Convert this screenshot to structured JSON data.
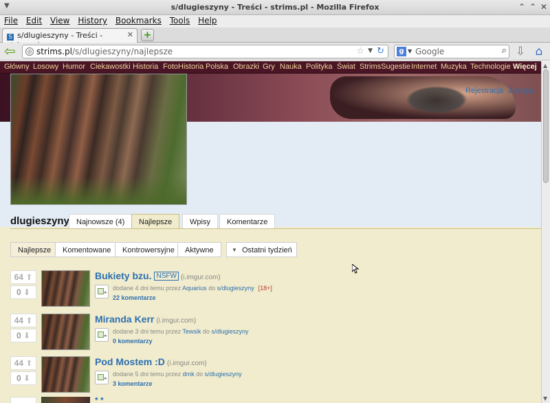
{
  "window": {
    "title": "s/dlugieszyny - Treści - strims.pl - Mozilla Firefox"
  },
  "menu": [
    "File",
    "Edit",
    "View",
    "History",
    "Bookmarks",
    "Tools",
    "Help"
  ],
  "tab": {
    "label": "s/dlugieszyny - Treści - strims.pl",
    "favicon": "S"
  },
  "url": {
    "host": "strims.pl",
    "path": "/s/dlugieszyny/najlepsze"
  },
  "search": {
    "engine_icon": "google-icon",
    "placeholder": "Google"
  },
  "site": {
    "nav": [
      "Główny",
      "Losowy",
      "Humor",
      "Ciekawostki",
      "Historia",
      "FotoHistoria",
      "Polska",
      "Obrazki",
      "Gry",
      "Nauka",
      "Polityka",
      "Świat",
      "StrimsSugestie",
      "Internet",
      "Muzyka",
      "Technologie"
    ],
    "nav_more": "Więcej",
    "register": "Rejestracja",
    "login": "Zaloguj",
    "strim_name": "dlugieszyny",
    "tabs": [
      "Najnowsze (4)",
      "Najlepsze",
      "Wpisy",
      "Komentarze"
    ],
    "active_tab": "Najlepsze",
    "filters": [
      "Najlepsze",
      "Komentowane",
      "Kontrowersyjne",
      "Aktywne"
    ],
    "active_filter": "Najlepsze",
    "period": "Ostatni tydzień"
  },
  "entries": [
    {
      "up": "64",
      "down": "0",
      "title": "Bukiety bzu.",
      "nsfw": "NSFW",
      "domain": "(i.imgur.com)",
      "meta_pre": "dodane 4 dni temu przez ",
      "author": "Aquarius",
      "meta_mid": " do ",
      "strim": "s/dlugieszyny",
      "badge": "[18+]",
      "comments": "22 komentarze"
    },
    {
      "up": "44",
      "down": "0",
      "title": "Miranda Kerr",
      "nsfw": "",
      "domain": "(i.imgur.com)",
      "meta_pre": "dodane 3 dni temu przez ",
      "author": "Tewsik",
      "meta_mid": " do ",
      "strim": "s/dlugieszyny",
      "badge": "",
      "comments": "0 komentarzy"
    },
    {
      "up": "44",
      "down": "0",
      "title": "Pod Mostem :D",
      "nsfw": "",
      "domain": "(i.imgur.com)",
      "meta_pre": "dodane 5 dni temu przez ",
      "author": "dmk",
      "meta_mid": " do ",
      "strim": "s/dlugieszyny",
      "badge": "",
      "comments": "3 komentarze"
    }
  ],
  "peek_title": "* *"
}
